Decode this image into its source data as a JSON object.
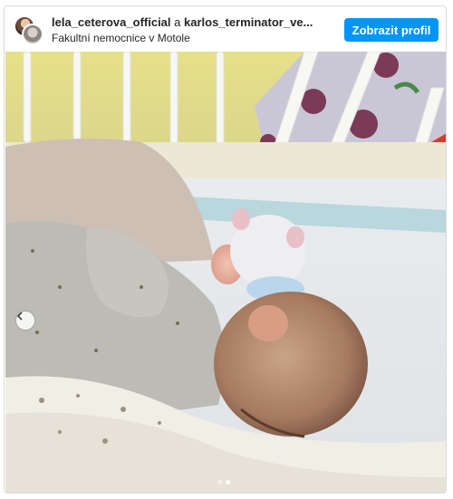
{
  "header": {
    "user1": "lela_ceterova_official",
    "connector": "a",
    "user2": "karlos_terminator_ve...",
    "location": "Fakultní nemocnice v Motole",
    "profile_button": "Zobrazit profil"
  },
  "carousel": {
    "slide_count": 2,
    "active_slide": 2
  },
  "colors": {
    "button": "#0095f6",
    "border": "#dbdbdb",
    "text": "#262626"
  },
  "icons": [
    "chevron-left-icon"
  ]
}
